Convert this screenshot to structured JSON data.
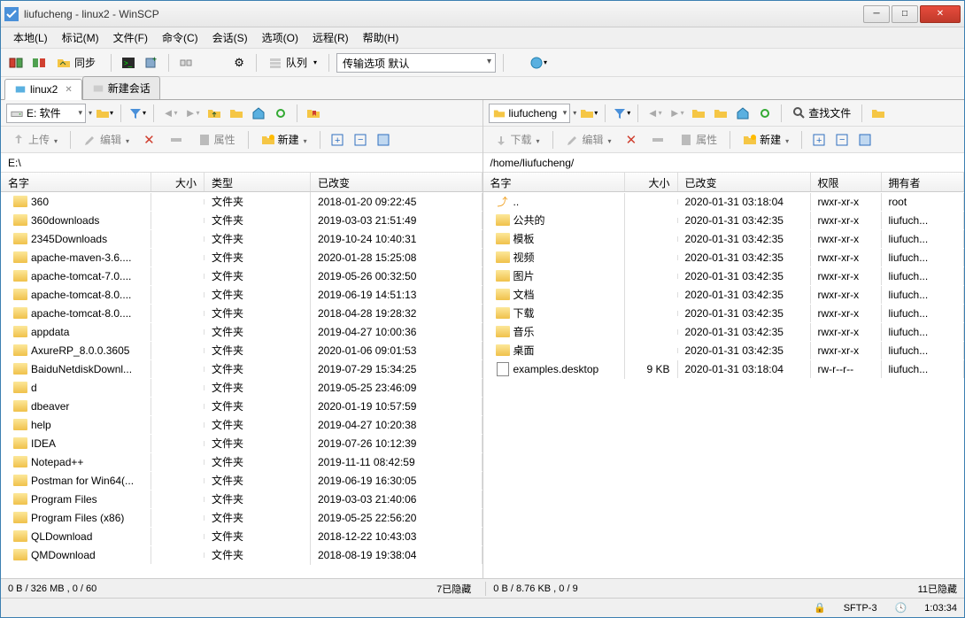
{
  "window": {
    "title": "liufucheng - linux2 - WinSCP"
  },
  "menu": {
    "local": "本地(L)",
    "mark": "标记(M)",
    "files": "文件(F)",
    "commands": "命令(C)",
    "session": "会话(S)",
    "options": "选项(O)",
    "remote": "远程(R)",
    "help": "帮助(H)"
  },
  "toolbar1": {
    "sync": "同步",
    "queue": "队列",
    "transfer_label": "传输选项 默认"
  },
  "tabs": {
    "session": "linux2",
    "new_session": "新建会话"
  },
  "left": {
    "drive": "E: 软件",
    "upload": "上传",
    "edit": "编辑",
    "props": "属性",
    "new": "新建",
    "path": "E:\\",
    "headers": {
      "name": "名字",
      "size": "大小",
      "type": "类型",
      "changed": "已改变"
    },
    "files": [
      {
        "name": "360",
        "type": "文件夹",
        "changed": "2018-01-20  09:22:45"
      },
      {
        "name": "360downloads",
        "type": "文件夹",
        "changed": "2019-03-03  21:51:49"
      },
      {
        "name": "2345Downloads",
        "type": "文件夹",
        "changed": "2019-10-24  10:40:31"
      },
      {
        "name": "apache-maven-3.6....",
        "type": "文件夹",
        "changed": "2020-01-28  15:25:08"
      },
      {
        "name": "apache-tomcat-7.0....",
        "type": "文件夹",
        "changed": "2019-05-26  00:32:50"
      },
      {
        "name": "apache-tomcat-8.0....",
        "type": "文件夹",
        "changed": "2019-06-19  14:51:13"
      },
      {
        "name": "apache-tomcat-8.0....",
        "type": "文件夹",
        "changed": "2018-04-28  19:28:32"
      },
      {
        "name": "appdata",
        "type": "文件夹",
        "changed": "2019-04-27  10:00:36"
      },
      {
        "name": "AxureRP_8.0.0.3605",
        "type": "文件夹",
        "changed": "2020-01-06  09:01:53"
      },
      {
        "name": "BaiduNetdiskDownl...",
        "type": "文件夹",
        "changed": "2019-07-29  15:34:25"
      },
      {
        "name": "d",
        "type": "文件夹",
        "changed": "2019-05-25  23:46:09"
      },
      {
        "name": "dbeaver",
        "type": "文件夹",
        "changed": "2020-01-19  10:57:59"
      },
      {
        "name": "help",
        "type": "文件夹",
        "changed": "2019-04-27  10:20:38"
      },
      {
        "name": "IDEA",
        "type": "文件夹",
        "changed": "2019-07-26  10:12:39"
      },
      {
        "name": "Notepad++",
        "type": "文件夹",
        "changed": "2019-11-11  08:42:59"
      },
      {
        "name": "Postman for Win64(...",
        "type": "文件夹",
        "changed": "2019-06-19  16:30:05"
      },
      {
        "name": "Program Files",
        "type": "文件夹",
        "changed": "2019-03-03  21:40:06"
      },
      {
        "name": "Program Files (x86)",
        "type": "文件夹",
        "changed": "2019-05-25  22:56:20"
      },
      {
        "name": "QLDownload",
        "type": "文件夹",
        "changed": "2018-12-22  10:43:03"
      },
      {
        "name": "QMDownload",
        "type": "文件夹",
        "changed": "2018-08-19  19:38:04"
      }
    ],
    "status": "0 B / 326 MB ,  0 / 60",
    "hidden": "7已隐藏"
  },
  "right": {
    "drive": "liufucheng",
    "download": "下载",
    "edit": "编辑",
    "props": "属性",
    "new": "新建",
    "find": "查找文件",
    "path": "/home/liufucheng/",
    "headers": {
      "name": "名字",
      "size": "大小",
      "changed": "已改变",
      "perm": "权限",
      "owner": "拥有者"
    },
    "up": "..",
    "files": [
      {
        "name": "..",
        "size": "",
        "changed": "2020-01-31 03:18:04",
        "perm": "rwxr-xr-x",
        "owner": "root",
        "icon": "up"
      },
      {
        "name": "公共的",
        "size": "",
        "changed": "2020-01-31 03:42:35",
        "perm": "rwxr-xr-x",
        "owner": "liufuch...",
        "icon": "folder"
      },
      {
        "name": "模板",
        "size": "",
        "changed": "2020-01-31 03:42:35",
        "perm": "rwxr-xr-x",
        "owner": "liufuch...",
        "icon": "folder"
      },
      {
        "name": "视频",
        "size": "",
        "changed": "2020-01-31 03:42:35",
        "perm": "rwxr-xr-x",
        "owner": "liufuch...",
        "icon": "folder"
      },
      {
        "name": "图片",
        "size": "",
        "changed": "2020-01-31 03:42:35",
        "perm": "rwxr-xr-x",
        "owner": "liufuch...",
        "icon": "folder"
      },
      {
        "name": "文档",
        "size": "",
        "changed": "2020-01-31 03:42:35",
        "perm": "rwxr-xr-x",
        "owner": "liufuch...",
        "icon": "folder"
      },
      {
        "name": "下载",
        "size": "",
        "changed": "2020-01-31 03:42:35",
        "perm": "rwxr-xr-x",
        "owner": "liufuch...",
        "icon": "folder"
      },
      {
        "name": "音乐",
        "size": "",
        "changed": "2020-01-31 03:42:35",
        "perm": "rwxr-xr-x",
        "owner": "liufuch...",
        "icon": "folder"
      },
      {
        "name": "桌面",
        "size": "",
        "changed": "2020-01-31 03:42:35",
        "perm": "rwxr-xr-x",
        "owner": "liufuch...",
        "icon": "folder"
      },
      {
        "name": "examples.desktop",
        "size": "9 KB",
        "changed": "2020-01-31 03:18:04",
        "perm": "rw-r--r--",
        "owner": "liufuch...",
        "icon": "file"
      }
    ],
    "status": "0 B / 8.76 KB ,  0 / 9",
    "hidden": "11已隐藏"
  },
  "footer": {
    "protocol": "SFTP-3",
    "time": "1:03:34"
  }
}
